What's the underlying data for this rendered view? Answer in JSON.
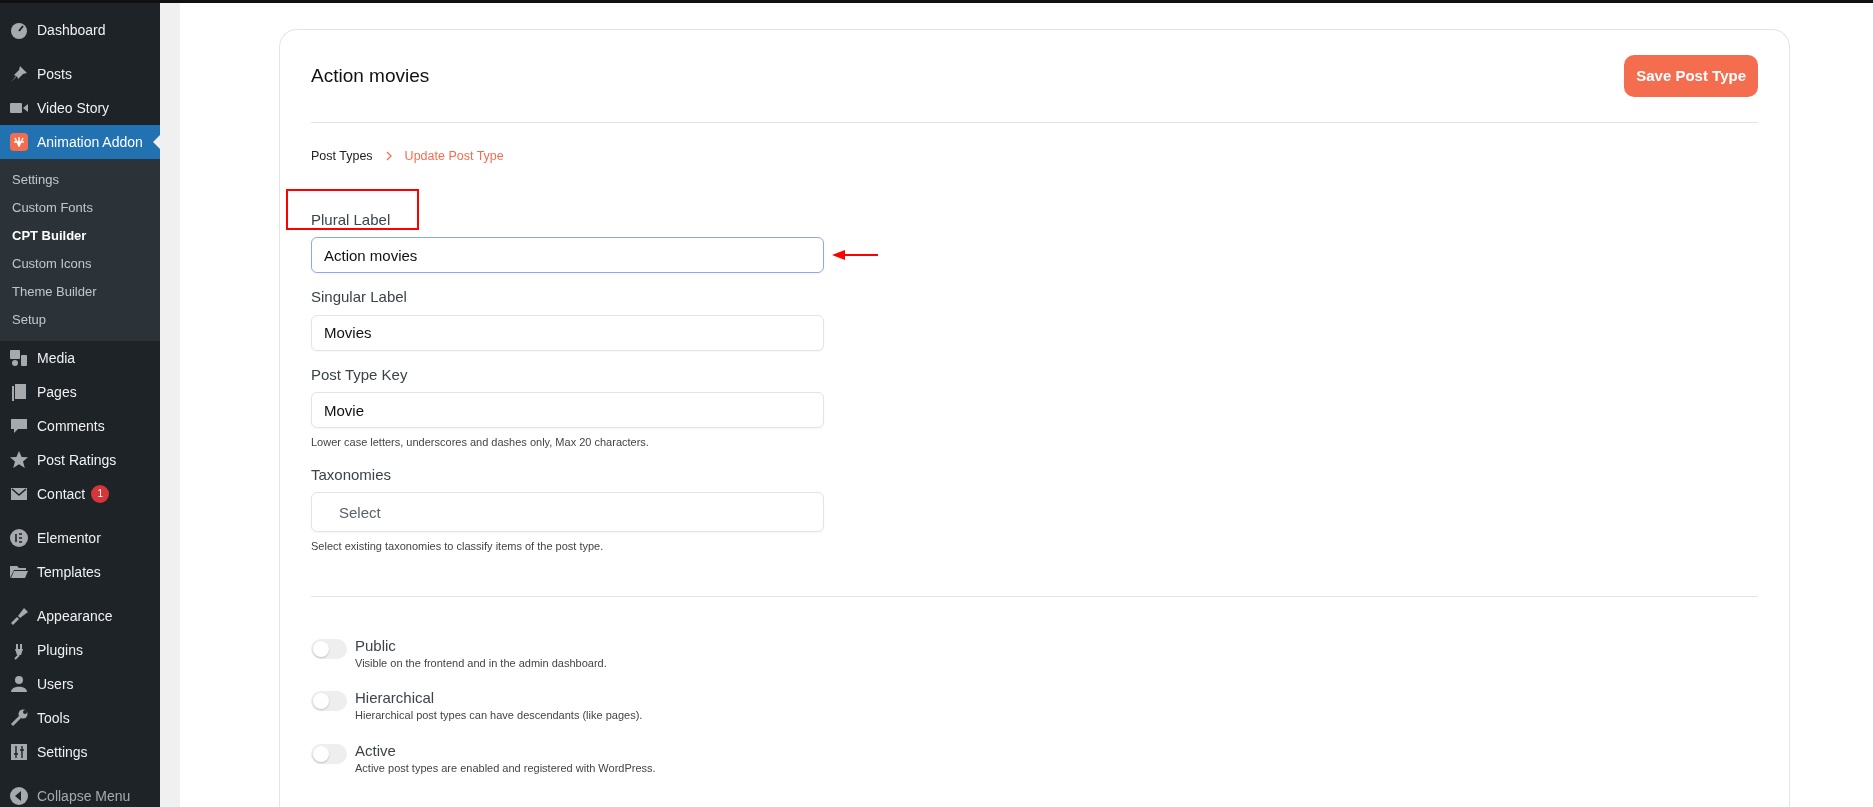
{
  "sidebar": {
    "groups": [
      [
        {
          "label": "Dashboard",
          "selected": false
        }
      ],
      [
        {
          "label": "Posts",
          "selected": false
        },
        {
          "label": "Video Story",
          "selected": false
        },
        {
          "label": "Animation Addon",
          "selected": true,
          "children": [
            {
              "label": "Settings",
              "selected": false
            },
            {
              "label": "Custom Fonts",
              "selected": false
            },
            {
              "label": "CPT Builder",
              "selected": true
            },
            {
              "label": "Custom Icons",
              "selected": false
            },
            {
              "label": "Theme Builder",
              "selected": false
            },
            {
              "label": "Setup",
              "selected": false
            }
          ]
        },
        {
          "label": "Media",
          "selected": false
        },
        {
          "label": "Pages",
          "selected": false
        },
        {
          "label": "Comments",
          "selected": false
        },
        {
          "label": "Post Ratings",
          "selected": false
        },
        {
          "label": "Contact",
          "selected": false,
          "badge": "1"
        }
      ],
      [
        {
          "label": "Elementor",
          "selected": false
        },
        {
          "label": "Templates",
          "selected": false
        }
      ],
      [
        {
          "label": "Appearance",
          "selected": false
        },
        {
          "label": "Plugins",
          "selected": false
        },
        {
          "label": "Users",
          "selected": false
        },
        {
          "label": "Tools",
          "selected": false
        },
        {
          "label": "Settings",
          "selected": false
        }
      ]
    ],
    "collapse": "Collapse Menu"
  },
  "card": {
    "title": "Action movies",
    "save_button": "Save Post Type",
    "breadcrumb": [
      {
        "label": "Post Types",
        "selected": false
      },
      {
        "label": "Update Post Type",
        "selected": true
      }
    ],
    "fields": [
      {
        "label": "Plural Label",
        "value": "Action movies",
        "focused": true,
        "annotated": true
      },
      {
        "label": "Singular Label",
        "value": "Movies",
        "focused": false,
        "annotated": false
      },
      {
        "label": "Post Type Key",
        "value": "Movie",
        "focused": false,
        "annotated": false,
        "hint": "Lower case letters, underscores and dashes only, Max 20 characters."
      },
      {
        "label": "Taxonomies",
        "placeholder": "Select",
        "focused": false,
        "annotated": false,
        "hint": "Select existing taxonomies to classify items of the post type."
      }
    ],
    "toggles": [
      {
        "label": "Public",
        "description": "Visible on the frontend and in the admin dashboard.",
        "on": false
      },
      {
        "label": "Hierarchical",
        "description": "Hierarchical post types can have descendants (like pages).",
        "on": false
      },
      {
        "label": "Active",
        "description": "Active post types are enabled and registered with WordPress.",
        "on": false
      }
    ]
  }
}
